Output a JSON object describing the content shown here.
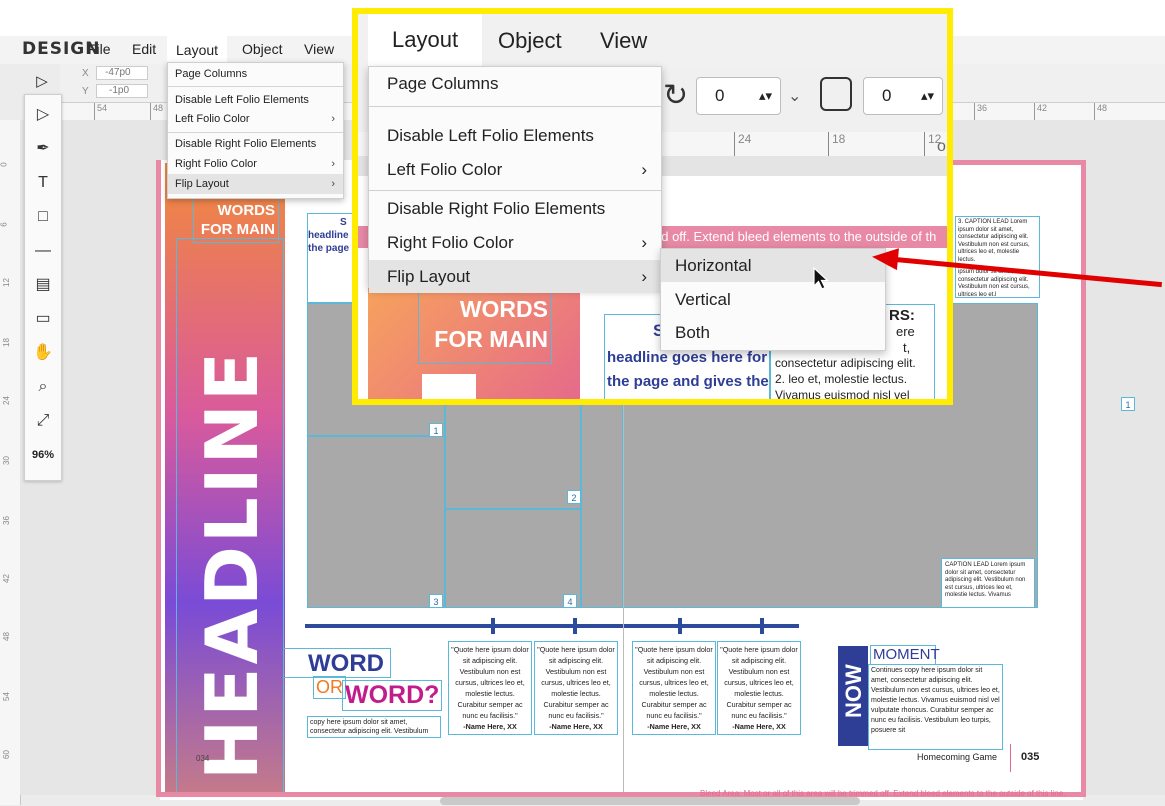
{
  "app": {
    "logo": "DESIGN",
    "menu": [
      "File",
      "Edit",
      "Layout",
      "Object",
      "View"
    ]
  },
  "controls": {
    "x_label": "X",
    "x_value": "-47p0",
    "y_label": "Y",
    "y_value": "-1p0",
    "rotation_value": "0",
    "corner_value": "0"
  },
  "ruler": {
    "h_ticks": [
      "54",
      "48",
      "36",
      "42",
      "48"
    ],
    "v_ticks": [
      "0",
      "6",
      "12",
      "18",
      "24",
      "30",
      "36",
      "42",
      "48",
      "54",
      "60"
    ],
    "zoom_ticks": [
      "24",
      "18",
      "12"
    ]
  },
  "toolbar": {
    "tools": [
      "select-icon",
      "direct-select-icon",
      "pen-icon",
      "text-icon",
      "rectangle-icon",
      "line-icon",
      "pages-icon",
      "comment-icon",
      "hand-icon",
      "zoom-icon",
      "fit-icon"
    ],
    "zoom_level": "96%"
  },
  "layout_menu": {
    "items": [
      {
        "label": "Page Columns",
        "submenu": false
      },
      {
        "label": "Disable Left Folio Elements",
        "submenu": false
      },
      {
        "label": "Left Folio Color",
        "submenu": true
      },
      {
        "label": "Disable Right Folio Elements",
        "submenu": false
      },
      {
        "label": "Right Folio Color",
        "submenu": true
      },
      {
        "label": "Flip Layout",
        "submenu": true
      }
    ],
    "flip_submenu": [
      "Horizontal",
      "Vertical",
      "Both"
    ],
    "highlighted": "Flip Layout",
    "submenu_highlighted": "Horizontal"
  },
  "document": {
    "headline": "HEADLINE",
    "words_for_main": [
      "WORDS",
      "FOR MAIN"
    ],
    "page_title_right": "oming Game  35",
    "bleed_strip_text": "ed off. Extend bleed elements to the outside of th",
    "headline_goes": "headline goes here for",
    "page_gives": "the page and gives the",
    "subhead_s": "S",
    "headline_small": "headline",
    "page_small": "the page",
    "rs_text": "RS:",
    "list_snippet": [
      "ere",
      "t,",
      "consectetur adipiscing elit.",
      "2.  leo et, molestie lectus.",
      "Vivamus euismod nisl vel"
    ],
    "caption_lead_top": "3. CAPTION LEAD Lorem ipsum dolor sit amet, consectetur adipiscing elit. Vestibulum non est cursus, ultrices leo et, molestie lectus.",
    "caption_lead_top2": "ipsum dolor sit amet, consectetur adipiscing elit. Vestibulum non est cursus, ultrices leo et.l",
    "caption_lead_bottom": "CAPTION LEAD Lorem ipsum dolor sit amet, consectetur adipiscing elit. Vestibulum non est cursus, ultrices leo et, molestie lectus. Vivamus",
    "word1": "WORD",
    "or": "OR",
    "word2": "WORD?",
    "copy_here": "copy here ipsum dolor sit amet, consectetur adipiscing elit. Vestibulum",
    "quotes": [
      {
        "text": "\"Quote here ipsum dolor sit adipiscing elit. Vestibulum non est cursus, ultrices leo et, molestie lectus. Curabitur semper ac nunc eu facilisis.\"",
        "name": "-Name Here, XX"
      },
      {
        "text": "\"Quote here ipsum dolor sit adipiscing elit. Vestibulum non est cursus, ultrices leo et, molestie lectus. Curabitur semper ac nunc eu facilisis.\"",
        "name": "-Name Here, XX"
      },
      {
        "text": "\"Quote here ipsum dolor sit adipiscing elit. Vestibulum non est cursus, ultrices leo et, molestie lectus. Curabitur semper ac nunc eu facilisis.\"",
        "name": "-Name Here, XX"
      },
      {
        "text": "\"Quote here ipsum dolor sit adipiscing elit. Vestibulum non est cursus, ultrices leo et, molestie lectus. Curabitur semper ac nunc eu facilisis.\"",
        "name": "-Name Here, XX"
      }
    ],
    "now": "NOW",
    "moment": "MOMENT",
    "moment_body": "Continues copy here ipsum dolor sit amet, consectetur adipiscing elit. Vestibulum non est cursus, ultrices leo et, molestie lectus. Vivamus euismod nisl vel vulputate rhoncus. Curabitur semper ac nunc eu facilisis. Vestibulum leo turpis, posuere sit",
    "folio_left": "034",
    "folio_right_label": "Homecoming Game",
    "folio_right": "035",
    "bleed_note": "Bleed Area: Most or all of this area will be trimmed off. Extend bleed elements to the outside of this line.",
    "frame_numbers": [
      "1",
      "2",
      "3",
      "4",
      "1"
    ]
  },
  "colors": {
    "accent_yellow": "#ffec00",
    "arrow_red": "#e00000",
    "bleed_pink": "#e88aa6",
    "navy": "#2e4a9c",
    "magenta": "#c21c8c",
    "orange": "#ef7a22",
    "frame_blue": "#5bb8d8"
  }
}
